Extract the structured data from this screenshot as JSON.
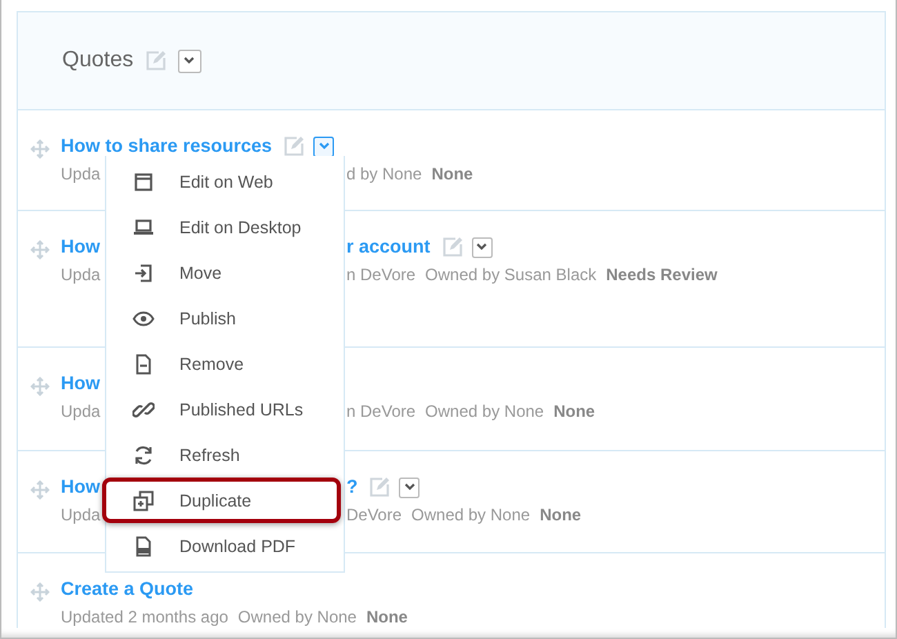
{
  "list": {
    "title": "Quotes"
  },
  "rows": [
    {
      "title": "How to share resources",
      "actions": {
        "menu_open": true
      },
      "meta_left": "Upda",
      "meta_right": [
        "d by None"
      ],
      "status": "None"
    },
    {
      "title_left": "How",
      "title_right": "r account",
      "actions": {
        "menu_open": false
      },
      "meta_left": "Upda",
      "meta_right": [
        "n DeVore",
        "Owned by Susan Black"
      ],
      "status": "Needs Review"
    },
    {
      "title_left": "How",
      "meta_left": "Upda",
      "meta_right": [
        "n DeVore",
        "Owned by None"
      ],
      "status": "None"
    },
    {
      "title_left": "How",
      "title_right": "?",
      "actions": {
        "menu_open": false
      },
      "meta_left": "Upda",
      "meta_right": [
        "DeVore",
        "Owned by None"
      ],
      "status": "None"
    },
    {
      "title": "Create a Quote",
      "meta": [
        "Updated 2 months ago",
        "Owned by None"
      ],
      "status": "None"
    }
  ],
  "menu": [
    {
      "kind": "window",
      "label": "Edit on Web",
      "highlighted": false
    },
    {
      "kind": "laptop",
      "label": "Edit on Desktop",
      "highlighted": false
    },
    {
      "kind": "move",
      "label": "Move",
      "highlighted": false
    },
    {
      "kind": "eye",
      "label": "Publish",
      "highlighted": false
    },
    {
      "kind": "remove",
      "label": "Remove",
      "highlighted": false
    },
    {
      "kind": "link",
      "label": "Published URLs",
      "highlighted": false
    },
    {
      "kind": "refresh",
      "label": "Refresh",
      "highlighted": false
    },
    {
      "kind": "duplicate",
      "label": "Duplicate",
      "highlighted": true
    },
    {
      "kind": "pdf",
      "label": "Download PDF",
      "highlighted": false
    }
  ]
}
